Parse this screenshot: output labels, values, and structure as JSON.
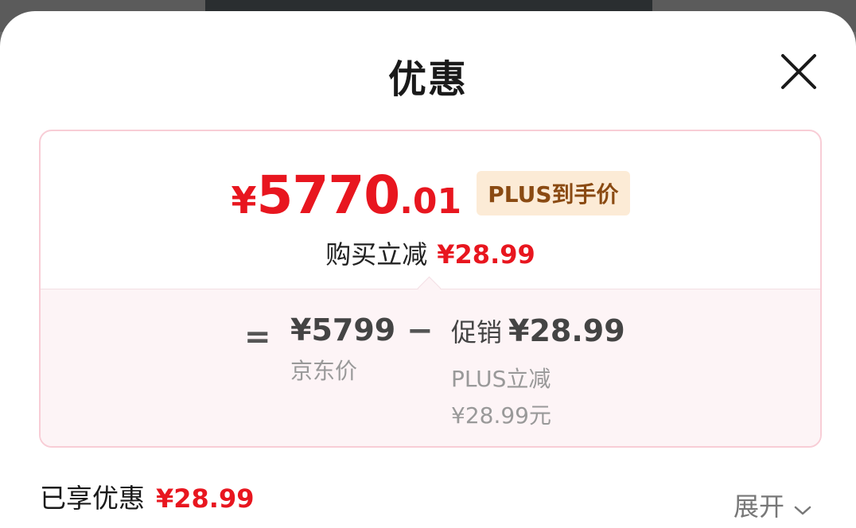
{
  "header": {
    "title": "优惠",
    "close_icon": "close-icon"
  },
  "summary": {
    "currency": "¥",
    "price_integer": "5770",
    "price_decimal": ".01",
    "plus_tag": "PLUS到手价",
    "reduce_label": "购买立减",
    "reduce_value": "¥28.99"
  },
  "breakdown": {
    "equals": "=",
    "jd_price": "¥5799",
    "jd_label": "京东价",
    "minus": "−",
    "promo_label": "促销",
    "promo_value": "¥28.99",
    "plus_reduce_label": "PLUS立减",
    "plus_reduce_value": "¥28.99元"
  },
  "footer": {
    "enjoyed_label": "已享优惠",
    "enjoyed_value": "¥28.99",
    "expand_label": "展开",
    "expand_icon": "chevron-down-icon"
  },
  "colors": {
    "accent_red": "#e8161f",
    "plus_tag_bg": "#fcebd6",
    "plus_tag_text": "#8a4a12",
    "card_border": "#f8cdd6"
  }
}
